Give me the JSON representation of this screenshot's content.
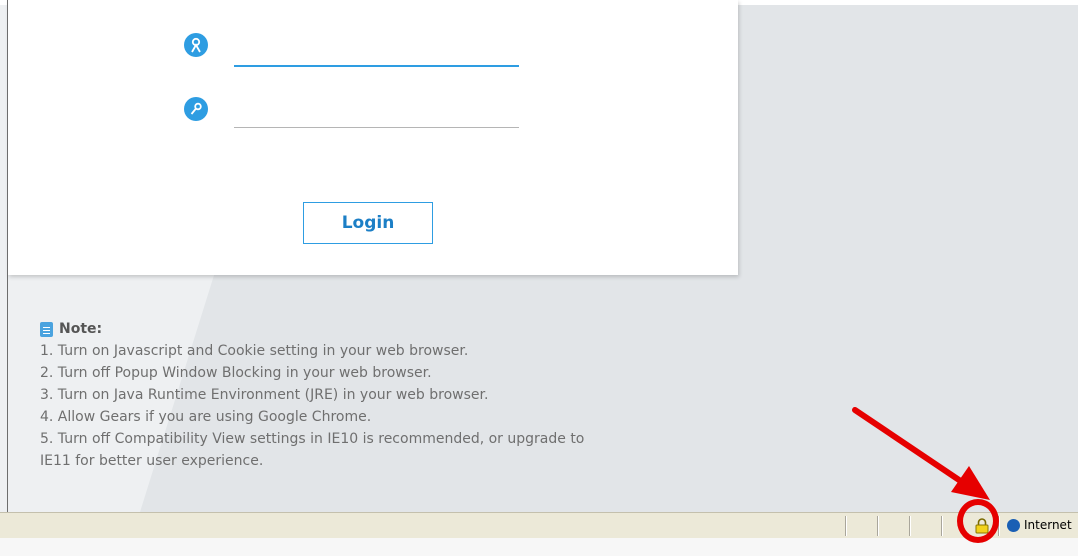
{
  "login": {
    "username_value": "",
    "password_value": "",
    "login_label": "Login"
  },
  "note": {
    "title": "Note:",
    "items": [
      "1. Turn on Javascript and Cookie setting in your web browser.",
      "2. Turn off Popup Window Blocking in your web browser.",
      "3. Turn on Java Runtime Environment (JRE) in your web browser.",
      "4. Allow Gears if you are using Google Chrome.",
      "5. Turn off Compatibility View settings in IE10 is recommended, or upgrade to",
      "IE11 for better user experience."
    ]
  },
  "statusbar": {
    "zone_label": "Internet"
  },
  "icons": {
    "username": "user-icon",
    "password": "key-icon",
    "note": "document-icon",
    "lock": "padlock-icon",
    "zone": "globe-icon"
  },
  "colors": {
    "accent": "#2e9de2",
    "annotation": "#e60000",
    "statusbar": "#ece9d8"
  }
}
